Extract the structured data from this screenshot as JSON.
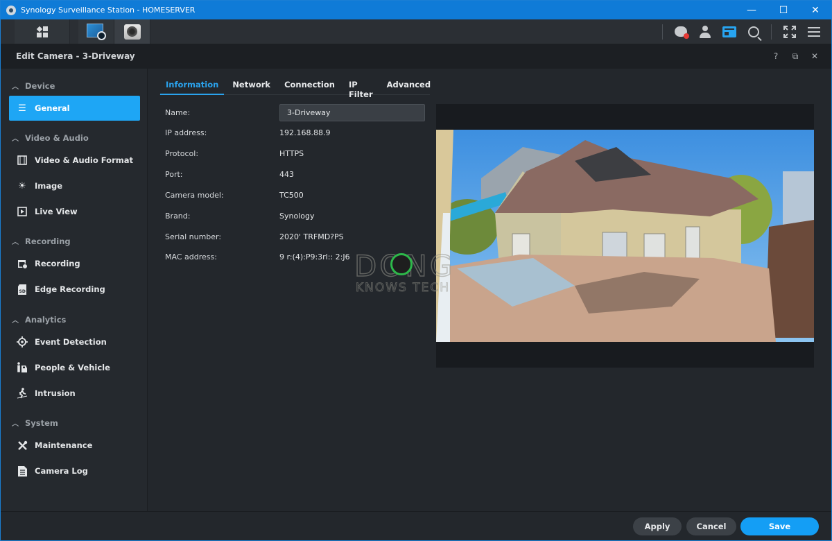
{
  "window": {
    "title": "Synology Surveillance Station - HOMESERVER",
    "controls": {
      "minimize": "—",
      "maximize": "☐",
      "close": "✕"
    }
  },
  "taskbar": {
    "apps": [
      {
        "name": "main-menu",
        "icon": "grid-icon"
      },
      {
        "name": "monitor-center",
        "icon": "monitor-center-icon"
      },
      {
        "name": "ip-camera",
        "icon": "camera-icon"
      }
    ],
    "right_icons": [
      "notification-icon",
      "user-icon",
      "news-icon",
      "search-icon",
      "fullscreen-icon",
      "menu-icon"
    ],
    "notification_badge_color": "#e53935",
    "accent": "#27a4f0"
  },
  "dialog": {
    "title": "Edit Camera - 3-Driveway",
    "controls": {
      "help": "?",
      "restore": "⧉",
      "close": "✕"
    }
  },
  "sidebar": {
    "sections": [
      {
        "label": "Device",
        "items": [
          {
            "label": "General",
            "icon": "list-icon",
            "active": true
          }
        ]
      },
      {
        "label": "Video & Audio",
        "items": [
          {
            "label": "Video & Audio Format",
            "icon": "film-icon"
          },
          {
            "label": "Image",
            "icon": "brightness-icon"
          },
          {
            "label": "Live View",
            "icon": "play-icon"
          }
        ]
      },
      {
        "label": "Recording",
        "items": [
          {
            "label": "Recording",
            "icon": "calendar-clock-icon"
          },
          {
            "label": "Edge Recording",
            "icon": "sd-card-icon"
          }
        ]
      },
      {
        "label": "Analytics",
        "items": [
          {
            "label": "Event Detection",
            "icon": "crosshair-icon"
          },
          {
            "label": "People & Vehicle",
            "icon": "people-vehicle-icon"
          },
          {
            "label": "Intrusion",
            "icon": "running-person-icon"
          }
        ]
      },
      {
        "label": "System",
        "items": [
          {
            "label": "Maintenance",
            "icon": "tools-icon"
          },
          {
            "label": "Camera Log",
            "icon": "log-icon"
          }
        ]
      }
    ]
  },
  "tabs": [
    {
      "label": "Information",
      "active": true
    },
    {
      "label": "Network"
    },
    {
      "label": "Connection"
    },
    {
      "label": "IP Filter"
    },
    {
      "label": "Advanced"
    }
  ],
  "info": {
    "name_label": "Name:",
    "name_value": "3-Driveway",
    "rows": [
      {
        "label": "IP address:",
        "value": "192.168.88.9"
      },
      {
        "label": "Protocol:",
        "value": "HTTPS"
      },
      {
        "label": "Port:",
        "value": "443"
      },
      {
        "label": "Camera model:",
        "value": "TC500"
      },
      {
        "label": "Brand:",
        "value": "Synology"
      },
      {
        "label": "Serial number:",
        "value": "2020' TRFMD?PS"
      },
      {
        "label": "MAC address:",
        "value": "9 r:(4):P9:3rl:: 2:J6"
      }
    ]
  },
  "preview": {
    "description": "Camera snapshot of a driveway and house"
  },
  "watermark": {
    "line1": "DONG",
    "line2": "KNOWS TECH"
  },
  "footer": {
    "apply": "Apply",
    "cancel": "Cancel",
    "save": "Save"
  },
  "colors": {
    "accent_blue": "#1ea6f5",
    "titlebar": "#0f7bd7",
    "background": "#23272c"
  }
}
